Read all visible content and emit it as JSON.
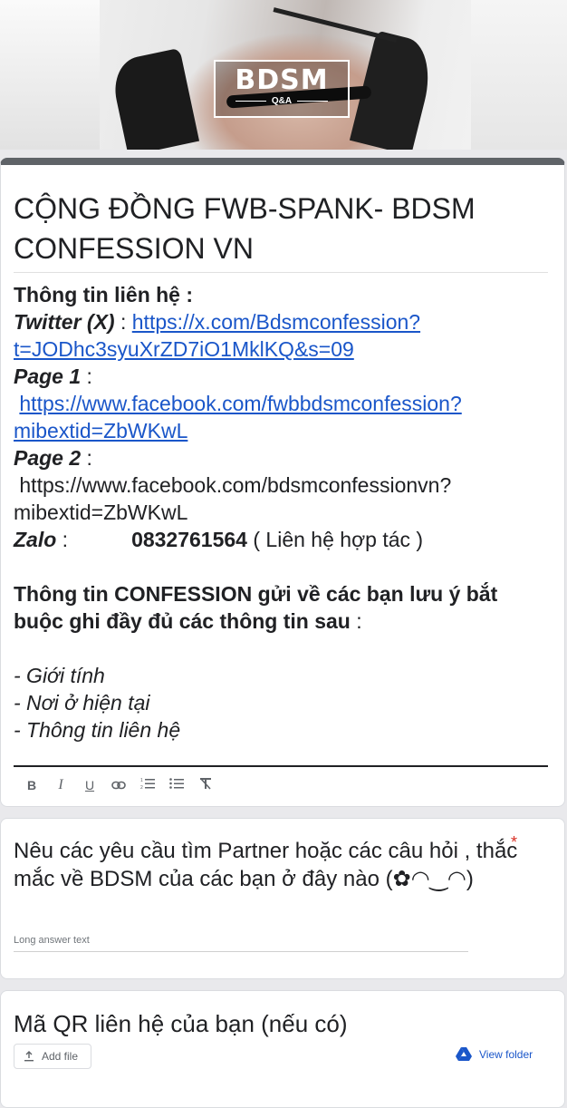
{
  "banner": {
    "logo_title": "BDSM",
    "logo_sub": "Q&A"
  },
  "form": {
    "title": "CỘNG ĐỒNG FWB-SPANK- BDSM CONFESSION VN",
    "contact_heading": "Thông tin liên hệ :",
    "twitter_label": "Twitter (X)",
    "twitter_sep": " : ",
    "twitter_url_1": "https://x.com/Bdsmconfession?",
    "twitter_url_2": "t=JODhc3syuXrZD7iO1MklKQ&s=09",
    "page1_label": "Page 1",
    "page1_sep": " :",
    "page1_url_1": "https://www.facebook.com/fwbbdsmconfession?",
    "page1_url_2": "mibextid=ZbWKwL",
    "page2_label": "Page 2",
    "page2_sep": " :",
    "page2_url_1": "https://www.facebook.com/bdsmconfessionvn?",
    "page2_url_2": "mibextid=ZbWKwL",
    "zalo_label": "Zalo",
    "zalo_sep": " :",
    "zalo_number": "0832761564",
    "zalo_note": " ( Liên hệ hợp tác )",
    "info_line_1": "Thông tin CONFESSION gửi về các bạn lưu ý bắt",
    "info_line_2": "buộc  ghi đầy đủ các thông tin sau",
    "info_colon": " :",
    "list_1": "- Giới tính",
    "list_2": "- Nơi ở hiện tại",
    "list_3": "- Thông tin liên hệ"
  },
  "toolbar": {
    "bold": "B",
    "italic": "I",
    "underline": "U",
    "link": "⊂⊃",
    "numbered_list": "≡",
    "bulleted_list": "☰",
    "clear_format": "T"
  },
  "question1": {
    "title": "Nêu các yêu cầu tìm Partner hoặc các câu hỏi , thắc mắc về BDSM của các bạn ở đây nào (✿◠‿◠)",
    "required_mark": "*",
    "placeholder": "Long answer text"
  },
  "question2": {
    "title": "Mã QR liên hệ của bạn (nếu có)",
    "add_file": "Add file",
    "view_folder": "View folder"
  },
  "colors": {
    "link": "#1a56c9",
    "required": "#d93025",
    "header_bar": "#5f6368"
  },
  "icons": [
    "upload-icon",
    "google-drive-icon"
  ]
}
